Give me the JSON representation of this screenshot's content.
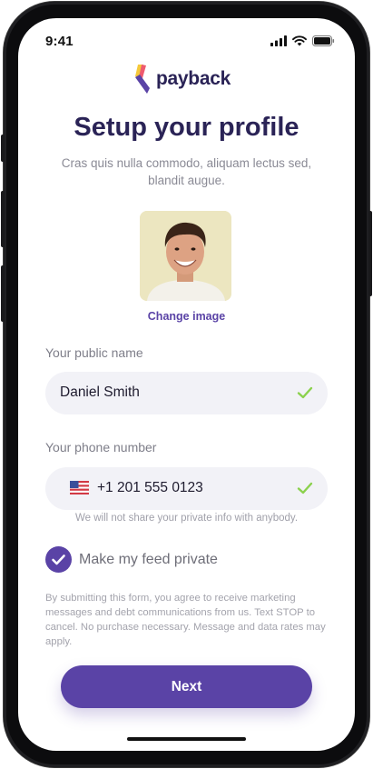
{
  "status_bar": {
    "time": "9:41"
  },
  "brand": {
    "name": "payback"
  },
  "header": {
    "title": "Setup your profile",
    "subtitle": "Cras quis nulla commodo, aliquam lectus sed, blandit augue."
  },
  "profile_image": {
    "change_label": "Change image"
  },
  "form": {
    "public_name": {
      "label": "Your public name",
      "value": "Daniel Smith",
      "valid": true
    },
    "phone": {
      "label": "Your phone number",
      "value": "+1 201 555 0123",
      "country_icon": "us-flag-icon",
      "valid": true,
      "hint": "We will not share your private info with anybody."
    },
    "private_feed": {
      "label": "Make my feed private",
      "checked": true
    }
  },
  "disclaimer": "By submitting this form, you agree to receive marketing messages and debt communications from us. Text STOP to cancel. No purchase necessary. Message and data rates may apply.",
  "actions": {
    "next_label": "Next"
  },
  "colors": {
    "primary": "#5a43a6",
    "title": "#2a2356",
    "success": "#8bd14d",
    "field_bg": "#f2f2f7"
  }
}
